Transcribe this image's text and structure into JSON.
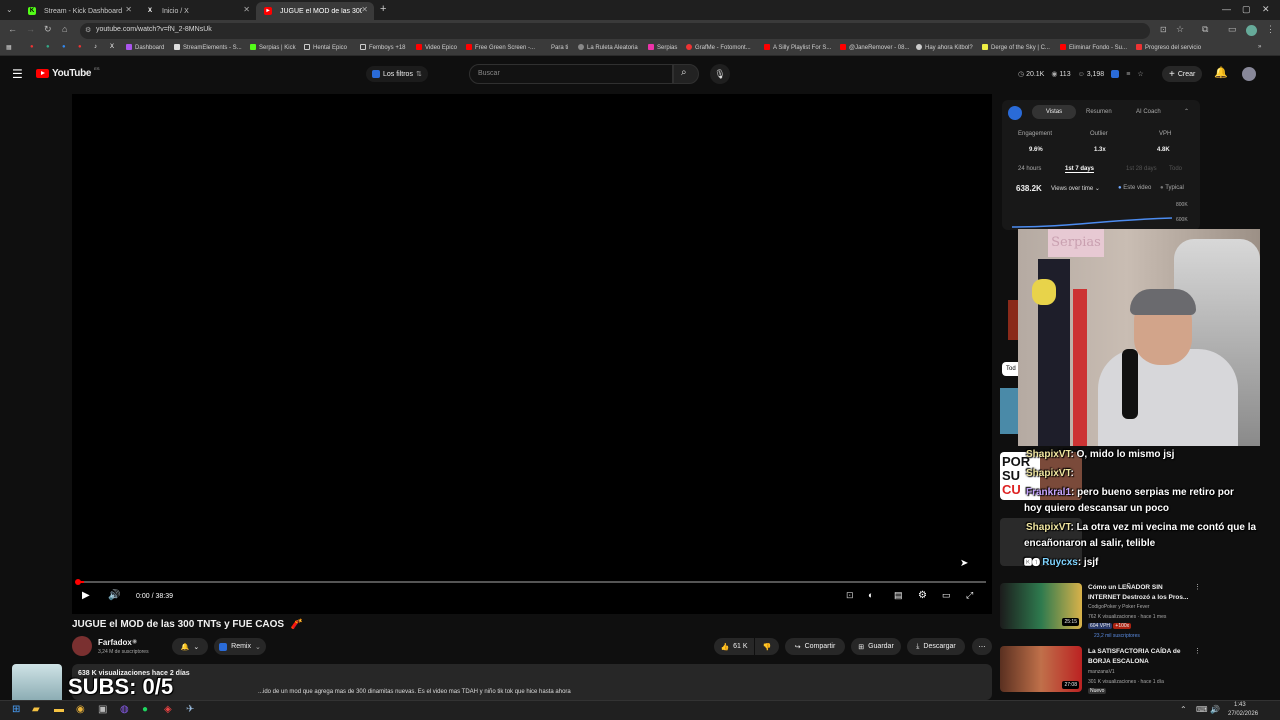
{
  "tabs": [
    {
      "title": "Stream - Kick Dashboard",
      "icon": "kick-icon",
      "color": "#53fc18"
    },
    {
      "title": "Inicio / X",
      "icon": "x-icon",
      "color": "#ffffff"
    },
    {
      "title": "JUGUE el MOD de las 300 TNT...",
      "icon": "youtube-icon",
      "color": "#ff0000"
    }
  ],
  "address": {
    "url": "youtube.com/watch?v=fN_2-8MNsUk"
  },
  "bookmarks": [
    "Dashboard",
    "StreamElements - S...",
    "Serpias | Kick",
    "Hentai Epico",
    "Femboys +18",
    "Video Epico",
    "Free Green Screen -...",
    "Para ti",
    "La Ruleta Aleatoria",
    "Serpias",
    "GrafMe - Fotomont...",
    "A Silly Playlist For S...",
    "@JaneRemover - 08...",
    "Hay ahora Kitbol?",
    "Derge of the Sky | C...",
    "Eliminar Fondo - Su...",
    "Progreso del servicio"
  ],
  "youtube": {
    "logo": "YouTube",
    "logo_sup": "ES",
    "filters_label": "Los filtros",
    "search_placeholder": "Buscar",
    "stats": {
      "a": "20.1K",
      "b": "113",
      "c": "3,198"
    },
    "create_label": "Crear"
  },
  "player": {
    "time": "0:00 / 38:39",
    "progress_fraction": 0.0
  },
  "video": {
    "title": "JUGUE el MOD de las 300 TNTs y FUE CAOS",
    "channel": "Farfadox",
    "subscribers": "3,24 M de suscriptores",
    "remix_label": "Remix",
    "likes": "61 K",
    "share_label": "Compartir",
    "save_label": "Guardar",
    "download_label": "Descargar",
    "views_meta": "638 K visualizaciones  hace 2 días",
    "description": "...ido de un mod que agrega mas de 300 dinamitas nuevas. Es el video mas TDAH y niño tik tok que hice hasta ahora"
  },
  "panel": {
    "tabs": [
      "Vistas",
      "Resumen",
      "AI Coach"
    ],
    "metrics": [
      {
        "label": "Engagement",
        "value": "9.6%"
      },
      {
        "label": "Outlier",
        "value": "1.3x"
      },
      {
        "label": "VPH",
        "value": "4.8K"
      }
    ],
    "ranges": [
      "24 hours",
      "1st 7 days",
      "1st 28 days",
      "Todo"
    ],
    "total": "638.2K",
    "views_selector": "Views over time",
    "legend_this": "Este video",
    "legend_typical": "Typical",
    "axis_top": "800K",
    "axis_mid": "600K"
  },
  "chat": [
    {
      "name": "ShapixVT",
      "msg": ": O, mido lo mismo jsj"
    },
    {
      "name": "ShapixVT",
      "msg": ":"
    },
    {
      "name": "Frankral1",
      "msg": ": pero bueno serpias me retiro por"
    },
    {
      "name": "",
      "msg": "hoy quiero descansar un poco"
    },
    {
      "name": "ShapixVT",
      "msg": ": La otra vez mi vecina me contó que la"
    },
    {
      "name": "",
      "msg": "encañonaron al salir, telible"
    },
    {
      "name": "Ruycxs",
      "msg": ": jsjf"
    }
  ],
  "recommended": [
    {
      "title": "Cómo un LEÑADOR SIN INTERNET Destrozó a los Pros...",
      "channel": "CodigoPoker y Poker Fever",
      "meta": "762 K visualizaciones · hace 1 mes",
      "badge1": "604 VPH",
      "badge2": "+100x",
      "subs": "23,2 mil suscriptores",
      "duration": "25:15"
    },
    {
      "title": "La SATISFACTORIA CAÍDA de BORJA ESCALONA",
      "channel": "manzanaV1",
      "meta": "301 K visualizaciones · hace 1 día",
      "badge1": "Nuevo",
      "duration": "27:08"
    }
  ],
  "overlay": {
    "subs_goal": "SUBS: 0/5"
  },
  "taskbar": {
    "time": "1:43",
    "date": "27/02/2026"
  },
  "bg_text": {
    "por": "POR",
    "su": "SU",
    "cu": "CU"
  }
}
